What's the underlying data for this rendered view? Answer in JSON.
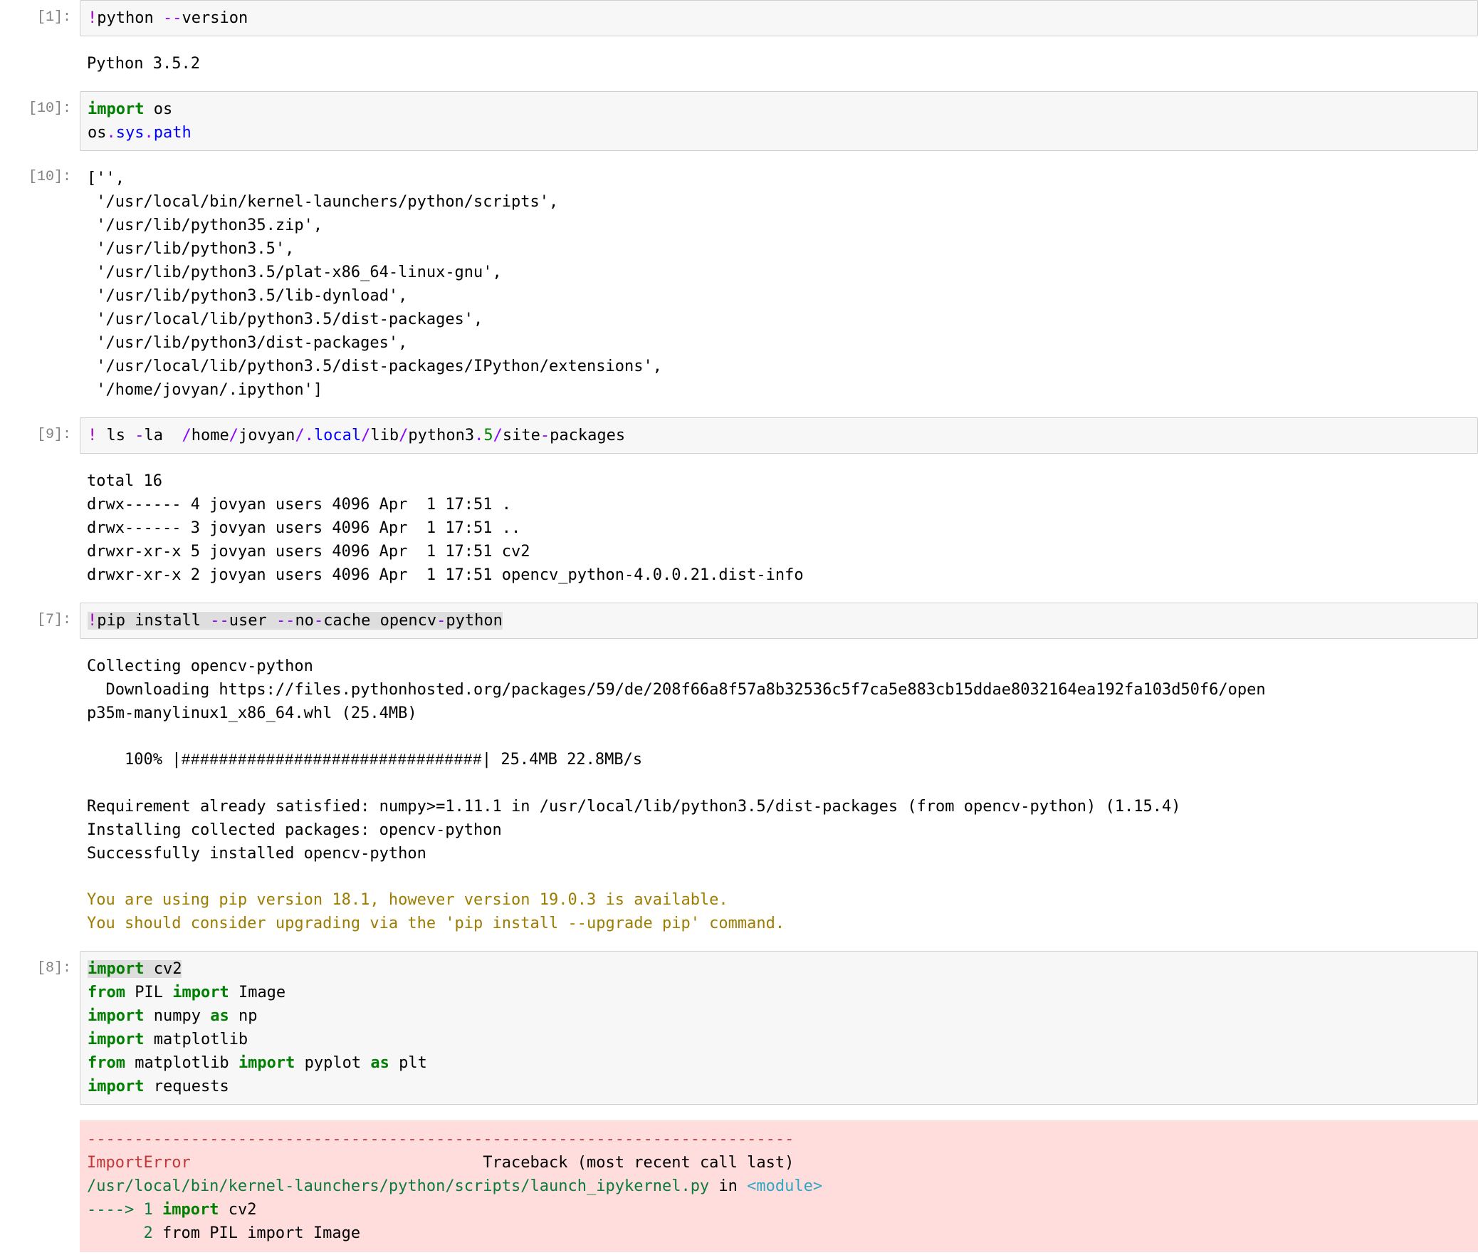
{
  "cells": [
    {
      "prompt": "[1]:",
      "input_tokens": [
        {
          "t": "!",
          "c": "bang"
        },
        {
          "t": "python ",
          "c": ""
        },
        {
          "t": "--",
          "c": "op"
        },
        {
          "t": "version",
          "c": ""
        }
      ],
      "outputs": [
        {
          "kind": "plain",
          "text": "Python 3.5.2"
        }
      ]
    },
    {
      "prompt": "[10]:",
      "input_tokens": [
        {
          "t": "import",
          "c": "kw"
        },
        {
          "t": " os\n",
          "c": ""
        },
        {
          "t": "os",
          "c": ""
        },
        {
          "t": ".",
          "c": "op"
        },
        {
          "t": "sys",
          "c": "nb"
        },
        {
          "t": ".",
          "c": "op"
        },
        {
          "t": "path",
          "c": "nb"
        }
      ],
      "outputs": [
        {
          "kind": "execresult",
          "prompt": "[10]:",
          "text": "['',\n '/usr/local/bin/kernel-launchers/python/scripts',\n '/usr/lib/python35.zip',\n '/usr/lib/python3.5',\n '/usr/lib/python3.5/plat-x86_64-linux-gnu',\n '/usr/lib/python3.5/lib-dynload',\n '/usr/local/lib/python3.5/dist-packages',\n '/usr/lib/python3/dist-packages',\n '/usr/local/lib/python3.5/dist-packages/IPython/extensions',\n '/home/jovyan/.ipython']"
        }
      ]
    },
    {
      "prompt": "[9]:",
      "input_tokens": [
        {
          "t": "!",
          "c": "bang"
        },
        {
          "t": " ls ",
          "c": ""
        },
        {
          "t": "-",
          "c": "op"
        },
        {
          "t": "la  ",
          "c": ""
        },
        {
          "t": "/",
          "c": "op"
        },
        {
          "t": "home",
          "c": ""
        },
        {
          "t": "/",
          "c": "op"
        },
        {
          "t": "jovyan",
          "c": ""
        },
        {
          "t": "/",
          "c": "op"
        },
        {
          "t": ".",
          "c": "op"
        },
        {
          "t": "local",
          "c": "nb"
        },
        {
          "t": "/",
          "c": "op"
        },
        {
          "t": "lib",
          "c": ""
        },
        {
          "t": "/",
          "c": "op"
        },
        {
          "t": "python3",
          "c": ""
        },
        {
          "t": ".",
          "c": "op"
        },
        {
          "t": "5",
          "c": "num"
        },
        {
          "t": "/",
          "c": "op"
        },
        {
          "t": "site",
          "c": ""
        },
        {
          "t": "-",
          "c": "op"
        },
        {
          "t": "packages",
          "c": ""
        }
      ],
      "outputs": [
        {
          "kind": "plain",
          "text": "total 16\ndrwx------ 4 jovyan users 4096 Apr  1 17:51 .\ndrwx------ 3 jovyan users 4096 Apr  1 17:51 ..\ndrwxr-xr-x 5 jovyan users 4096 Apr  1 17:51 cv2\ndrwxr-xr-x 2 jovyan users 4096 Apr  1 17:51 opencv_python-4.0.0.21.dist-info"
        }
      ]
    },
    {
      "prompt": "[7]:",
      "input_tokens": [
        {
          "t": "!",
          "c": "bang hl"
        },
        {
          "t": "pip install ",
          "c": "hl"
        },
        {
          "t": "--",
          "c": "op hl"
        },
        {
          "t": "user ",
          "c": "hl"
        },
        {
          "t": "--",
          "c": "op hl"
        },
        {
          "t": "no",
          "c": "hl"
        },
        {
          "t": "-",
          "c": "op hl"
        },
        {
          "t": "cache opencv",
          "c": "hl"
        },
        {
          "t": "-",
          "c": "op hl"
        },
        {
          "t": "python",
          "c": "hl"
        }
      ],
      "outputs": [
        {
          "kind": "plain",
          "text": "Collecting opencv-python\n  Downloading https://files.pythonhosted.org/packages/59/de/208f66a8f57a8b32536c5f7ca5e883cb15ddae8032164ea192fa103d50f6/open\np35m-manylinux1_x86_64.whl (25.4MB)"
        },
        {
          "kind": "progress",
          "prefix": "    100% |",
          "bar": "################################",
          "suffix": "| 25.4MB 22.8MB/s"
        },
        {
          "kind": "plain",
          "text": "Requirement already satisfied: numpy>=1.11.1 in /usr/local/lib/python3.5/dist-packages (from opencv-python) (1.15.4)\nInstalling collected packages: opencv-python\nSuccessfully installed opencv-python"
        },
        {
          "kind": "warn",
          "text": "You are using pip version 18.1, however version 19.0.3 is available.\nYou should consider upgrading via the 'pip install --upgrade pip' command."
        }
      ]
    },
    {
      "prompt": "[8]:",
      "input_tokens": [
        {
          "t": "import",
          "c": "kw hl"
        },
        {
          "t": " cv2",
          "c": "hl"
        },
        {
          "t": "\n",
          "c": ""
        },
        {
          "t": "from",
          "c": "kw"
        },
        {
          "t": " PIL ",
          "c": ""
        },
        {
          "t": "import",
          "c": "kw"
        },
        {
          "t": " Image\n",
          "c": ""
        },
        {
          "t": "import",
          "c": "kw"
        },
        {
          "t": " numpy ",
          "c": ""
        },
        {
          "t": "as",
          "c": "kw"
        },
        {
          "t": " np\n",
          "c": ""
        },
        {
          "t": "import",
          "c": "kw"
        },
        {
          "t": " matplotlib\n",
          "c": ""
        },
        {
          "t": "from",
          "c": "kw"
        },
        {
          "t": " matplotlib ",
          "c": ""
        },
        {
          "t": "import",
          "c": "kw"
        },
        {
          "t": " pyplot ",
          "c": ""
        },
        {
          "t": "as",
          "c": "kw"
        },
        {
          "t": " plt\n",
          "c": ""
        },
        {
          "t": "import",
          "c": "kw"
        },
        {
          "t": " requests",
          "c": ""
        }
      ],
      "outputs": [
        {
          "kind": "error",
          "lines": [
            [
              {
                "t": "---------------------------------------------------------------------------",
                "c": "err-dash"
              }
            ],
            [
              {
                "t": "ImportError",
                "c": "err-name"
              },
              {
                "t": "                               Traceback (most recent call last)",
                "c": ""
              }
            ],
            [
              {
                "t": "/usr/local/bin/kernel-launchers/python/scripts/launch_ipykernel.py",
                "c": "err-file"
              },
              {
                "t": " in ",
                "c": ""
              },
              {
                "t": "<module>",
                "c": "err-mod"
              }
            ],
            [
              {
                "t": "----> 1 ",
                "c": "err-arrow"
              },
              {
                "t": "import",
                "c": "kw"
              },
              {
                "t": " cv2",
                "c": ""
              }
            ],
            [
              {
                "t": "      2 ",
                "c": "err-arrow"
              },
              {
                "t": "from",
                "c": ""
              },
              {
                "t": " PIL ",
                "c": ""
              },
              {
                "t": "import",
                "c": ""
              },
              {
                "t": " Image",
                "c": ""
              }
            ]
          ]
        }
      ]
    }
  ]
}
